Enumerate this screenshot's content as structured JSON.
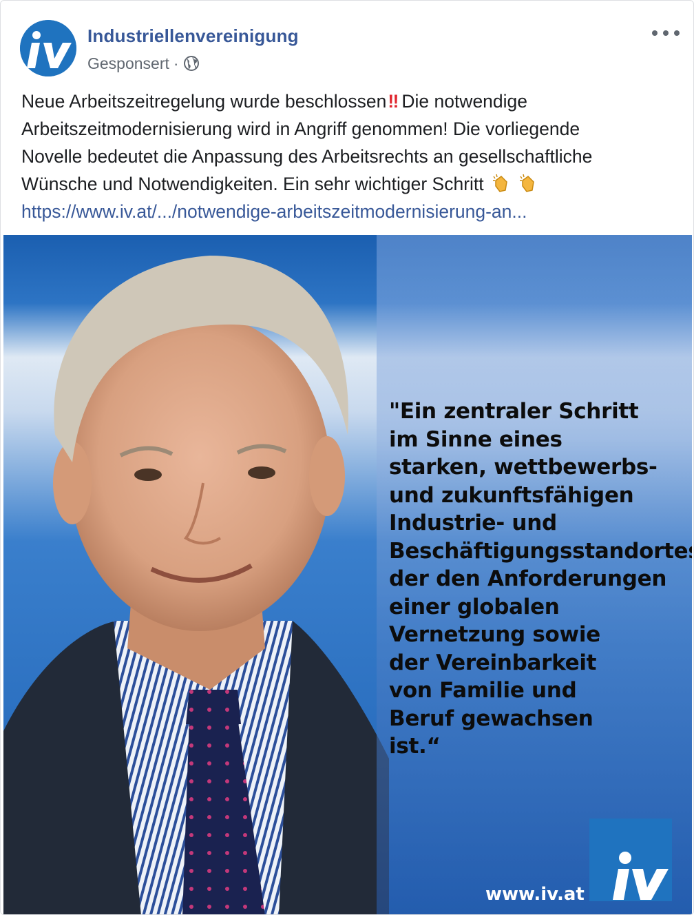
{
  "post": {
    "page_name": "Industriellenvereinigung",
    "sponsored_label": "Gesponsert",
    "separator": "·",
    "avatar_text": "iv",
    "text_lines": [
      "Neue Arbeitszeitregelung wurde beschlossen",
      "Die notwendige",
      "Arbeitszeitmodernisierung wird in Angriff genommen! Die vorliegende",
      "Novelle bedeutet die Anpassung des Arbeitsrechts an gesellschaftliche",
      "Wünsche und Notwendigkeiten. Ein sehr wichtiger Schritt"
    ],
    "emoji_bangbang": "‼",
    "link_text": "https://www.iv.at/.../notwendige-arbeitszeitmodernisierung-an..."
  },
  "image": {
    "quote_lines": [
      "\"Ein zentraler Schritt",
      "im Sinne eines",
      "starken, wettbewerbs-",
      "und zukunftsfähigen",
      "Industrie- und",
      "Beschäftigungsstandortes,",
      "der den Anforderungen",
      "einer globalen",
      "Vernetzung sowie",
      "der Vereinbarkeit",
      "von Familie und",
      "Beruf gewachsen",
      "ist.“"
    ],
    "website": "www.iv.at",
    "logo_text": "iv"
  },
  "colors": {
    "brand_blue": "#1f73bf",
    "link_blue": "#385898",
    "meta_gray": "#606770"
  },
  "icons": {
    "globe": "globe-icon",
    "more": "more-options-icon",
    "clap": "clapping-hands-icon"
  }
}
